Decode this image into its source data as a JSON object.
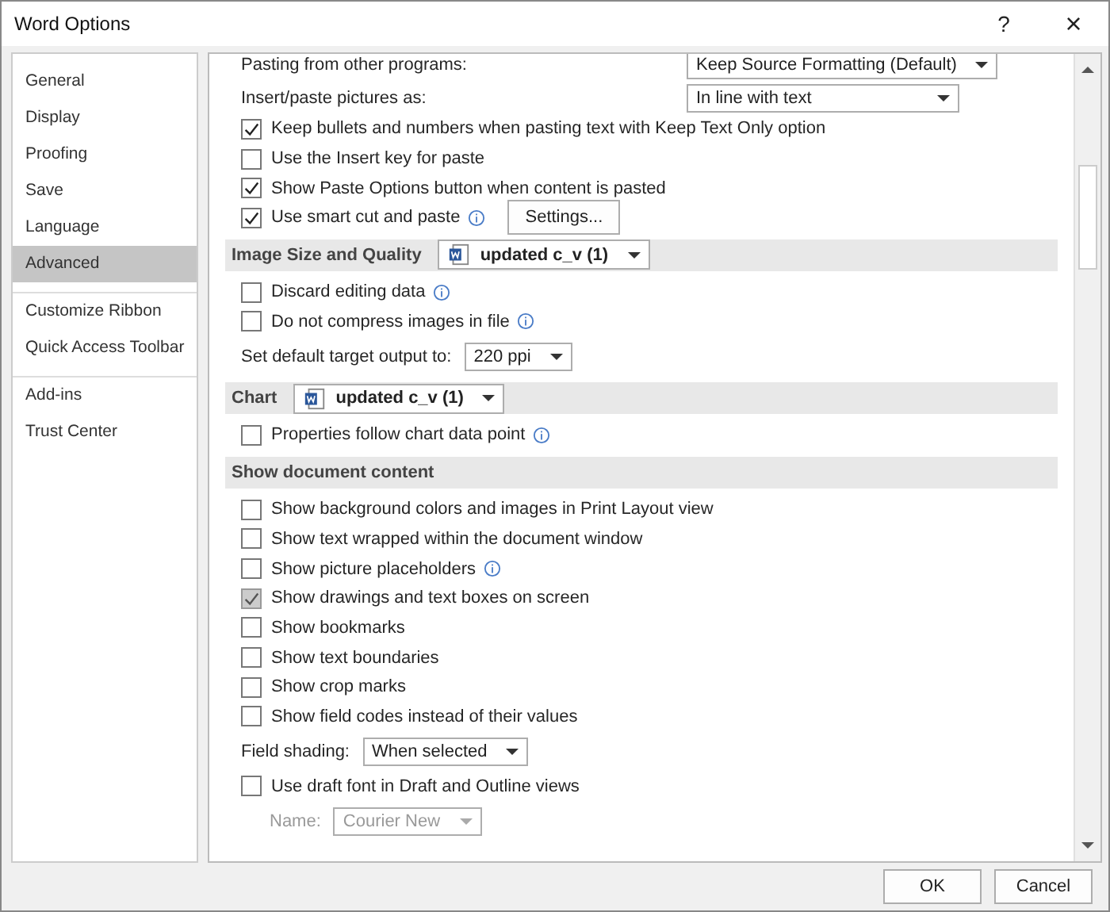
{
  "window": {
    "title": "Word Options",
    "help": "?",
    "close": "×"
  },
  "sidebar": {
    "items": [
      {
        "label": "General",
        "selected": false,
        "group_start": false
      },
      {
        "label": "Display",
        "selected": false,
        "group_start": false
      },
      {
        "label": "Proofing",
        "selected": false,
        "group_start": false
      },
      {
        "label": "Save",
        "selected": false,
        "group_start": false
      },
      {
        "label": "Language",
        "selected": false,
        "group_start": false
      },
      {
        "label": "Advanced",
        "selected": true,
        "group_start": false
      },
      {
        "label": "Customize Ribbon",
        "selected": false,
        "group_start": true
      },
      {
        "label": "Quick Access Toolbar",
        "selected": false,
        "group_start": false
      },
      {
        "label": "Add-ins",
        "selected": false,
        "group_start": true
      },
      {
        "label": "Trust Center",
        "selected": false,
        "group_start": false
      }
    ]
  },
  "content": [
    {
      "kind": "dropdown",
      "label": "Pasting from other programs:",
      "value": "Keep Source Formatting (Default)"
    },
    {
      "kind": "dropdown",
      "label": "Insert/paste pictures as:",
      "value": "In line with text"
    },
    {
      "kind": "checkbox",
      "label": "Keep bullets and numbers when pasting text with Keep Text Only option",
      "checked": true,
      "disabled": false,
      "info": false
    },
    {
      "kind": "checkbox",
      "label": "Use the Insert key for paste",
      "checked": false,
      "disabled": false,
      "info": false
    },
    {
      "kind": "checkbox",
      "label": "Show Paste Options button when content is pasted",
      "checked": true,
      "disabled": false,
      "info": false
    },
    {
      "kind": "checkbox",
      "label": "Use smart cut and paste",
      "checked": true,
      "disabled": false,
      "info": true,
      "button": "Settings..."
    },
    {
      "kind": "section",
      "label": "Image Size and Quality",
      "document": "updated c_v (1)"
    },
    {
      "kind": "checkbox",
      "label": "Discard editing data",
      "checked": false,
      "disabled": false,
      "info": true
    },
    {
      "kind": "checkbox",
      "label": "Do not compress images in file",
      "checked": false,
      "disabled": false,
      "info": true
    },
    {
      "kind": "select",
      "label": "Set default target output to:",
      "value": "220 ppi",
      "disabled": false
    },
    {
      "kind": "section",
      "label": "Chart",
      "document": "updated c_v (1)"
    },
    {
      "kind": "checkbox",
      "label": "Properties follow chart data point",
      "checked": false,
      "disabled": false,
      "info": true
    },
    {
      "kind": "section",
      "label": "Show document content"
    },
    {
      "kind": "checkbox",
      "label": "Show background colors and images in Print Layout view",
      "checked": false,
      "disabled": false,
      "info": false
    },
    {
      "kind": "checkbox",
      "label": "Show text wrapped within the document window",
      "checked": false,
      "disabled": false,
      "info": false
    },
    {
      "kind": "checkbox",
      "label": "Show picture placeholders",
      "checked": false,
      "disabled": false,
      "info": true
    },
    {
      "kind": "checkbox",
      "label": "Show drawings and text boxes on screen",
      "checked": true,
      "disabled": true,
      "info": false
    },
    {
      "kind": "checkbox",
      "label": "Show bookmarks",
      "checked": false,
      "disabled": false,
      "info": false
    },
    {
      "kind": "checkbox",
      "label": "Show text boundaries",
      "checked": false,
      "disabled": false,
      "info": false
    },
    {
      "kind": "checkbox",
      "label": "Show crop marks",
      "checked": false,
      "disabled": false,
      "info": false
    },
    {
      "kind": "checkbox",
      "label": "Show field codes instead of their values",
      "checked": false,
      "disabled": false,
      "info": false
    },
    {
      "kind": "select",
      "label": "Field shading:",
      "value": "When selected",
      "disabled": false
    },
    {
      "kind": "checkbox",
      "label": "Use draft font in Draft and Outline views",
      "checked": false,
      "disabled": false,
      "info": false
    },
    {
      "kind": "select",
      "label": "Name:",
      "value": "Courier New",
      "disabled": true
    }
  ],
  "buttons": [
    "OK",
    "Cancel"
  ]
}
